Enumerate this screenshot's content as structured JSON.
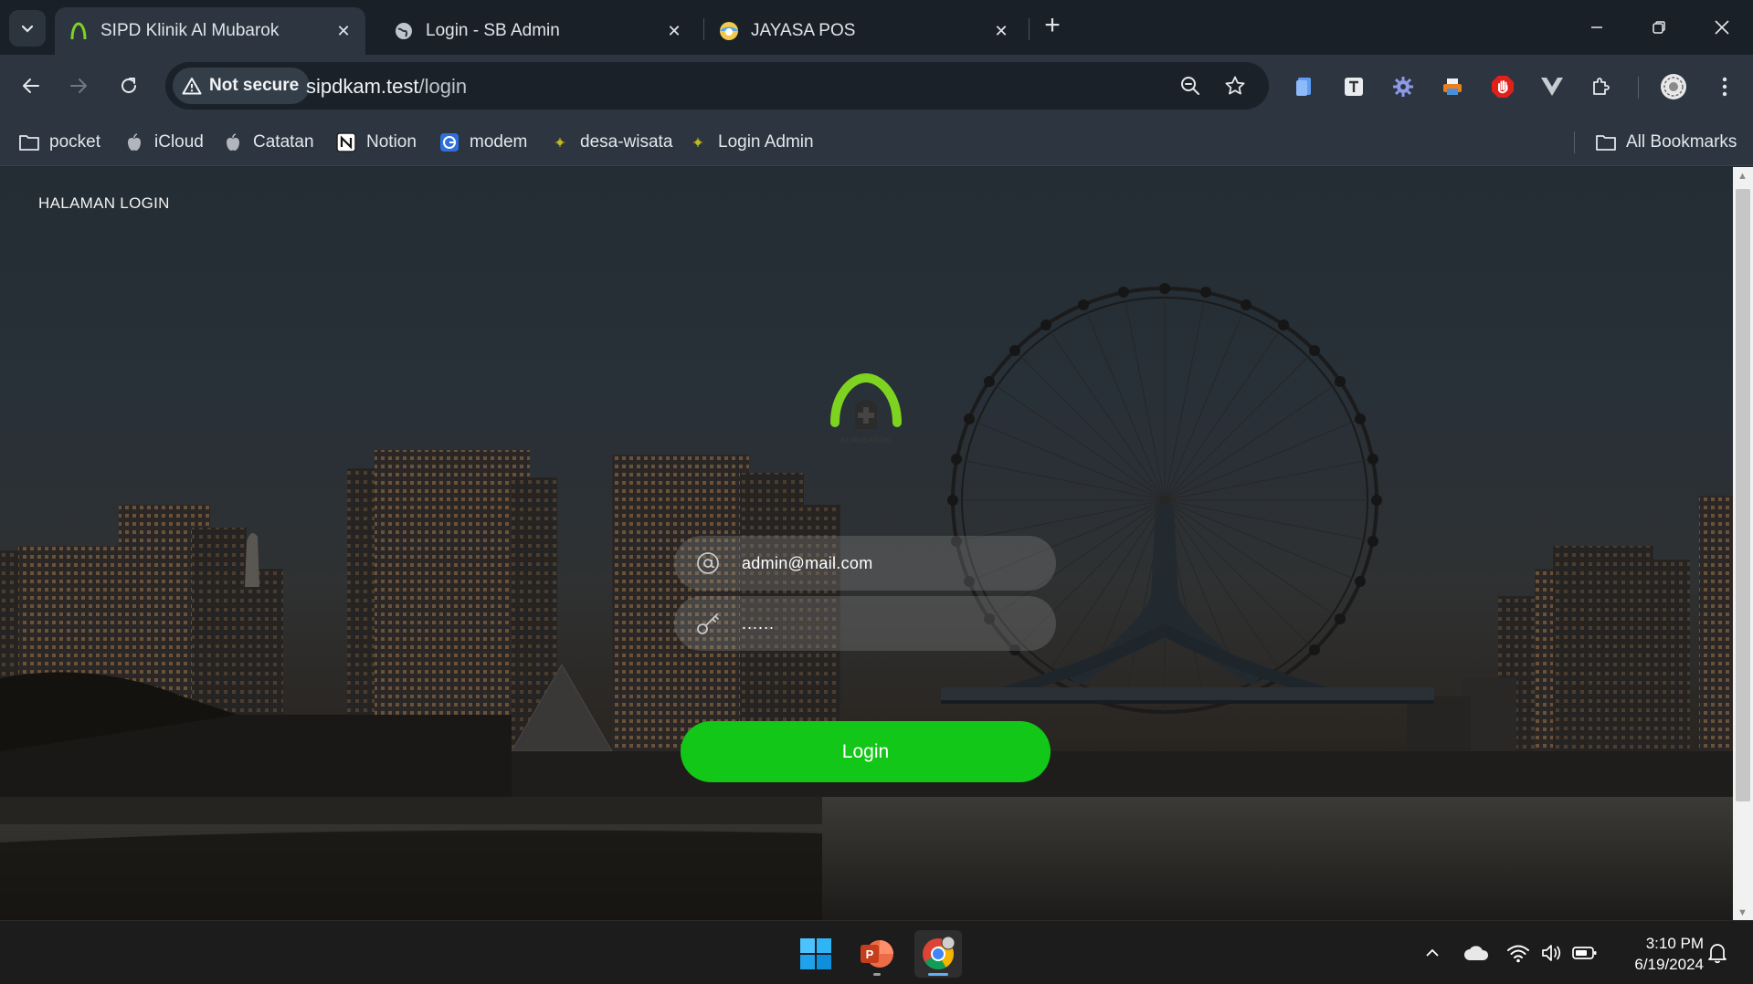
{
  "browser": {
    "tabs": [
      {
        "title": "SIPD Klinik Al Mubarok",
        "active": true
      },
      {
        "title": "Login - SB Admin",
        "active": false
      },
      {
        "title": "JAYASA POS",
        "active": false
      }
    ],
    "security_label": "Not secure",
    "url_host": "sipdkam.test",
    "url_path": "/login"
  },
  "bookmarks": [
    {
      "label": "pocket",
      "icon": "folder-icon"
    },
    {
      "label": "iCloud",
      "icon": "apple-icon"
    },
    {
      "label": "Catatan",
      "icon": "apple-icon"
    },
    {
      "label": "Notion",
      "icon": "notion-icon"
    },
    {
      "label": "modem",
      "icon": "modem-icon"
    },
    {
      "label": "desa-wisata",
      "icon": "site-icon"
    },
    {
      "label": "Login Admin",
      "icon": "site-icon"
    }
  ],
  "all_bookmarks_label": "All Bookmarks",
  "page": {
    "title": "HALAMAN LOGIN",
    "logo_text": "ALMUBAROK",
    "email_value": "admin@mail.com",
    "password_value": "......",
    "login_label": "Login"
  },
  "taskbar": {
    "time": "3:10 PM",
    "date": "6/19/2024"
  },
  "colors": {
    "accent_green": "#13c718",
    "logo_green": "#7ed321"
  }
}
